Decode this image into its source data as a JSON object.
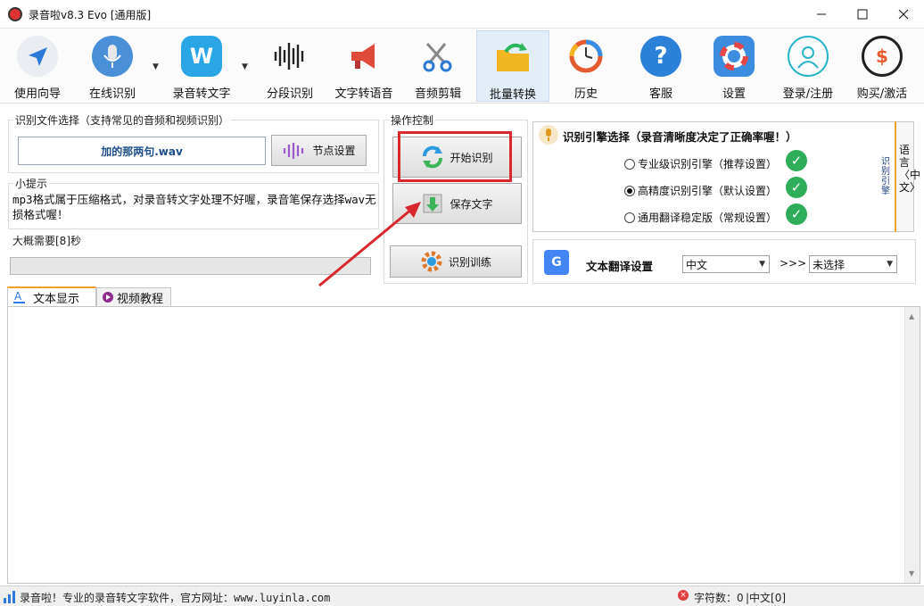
{
  "window": {
    "title": "录音啦v8.3 Evo [通用版]"
  },
  "toolbar": {
    "items": [
      {
        "label": "使用向导"
      },
      {
        "label": "在线识别"
      },
      {
        "label": "录音转文字"
      },
      {
        "label": "分段识别"
      },
      {
        "label": "文字转语音"
      },
      {
        "label": "音频剪辑"
      },
      {
        "label": "批量转换"
      },
      {
        "label": "历史"
      },
      {
        "label": "客服"
      },
      {
        "label": "设置"
      },
      {
        "label": "登录/注册"
      },
      {
        "label": "购买/激活"
      }
    ],
    "active": "批量转换"
  },
  "file_select": {
    "title": "识别文件选择（支持常见的音频和视频识别）",
    "filename": "加的那两句.wav",
    "segment_button": "节点设置"
  },
  "hint": {
    "title": "小提示",
    "text": "mp3格式属于压缩格式，对录音转文字处理不好喔，录音笔保存选择wav无损格式喔！"
  },
  "estimate": {
    "label": "大概需要[8]秒",
    "progress": 0
  },
  "operation": {
    "title": "操作控制",
    "start_button": "开始识别",
    "save_button": "保存文字",
    "train_button": "识别训练"
  },
  "engine": {
    "title": "识别引擎选择（录音清晰度决定了正确率喔！）",
    "options": [
      {
        "label": "专业级识别引擎（推荐设置）",
        "selected": false
      },
      {
        "label": "高精度识别引擎（默认设置）",
        "selected": true
      },
      {
        "label": "通用翻译稳定版（常规设置）",
        "selected": false
      }
    ],
    "side_tab_lang": "语言〈中文〉",
    "side_tab_engine": "识别引擎"
  },
  "translate": {
    "label": "文本翻译设置",
    "source": "中文",
    "arrow": ">>>",
    "target": "未选择"
  },
  "tabs": [
    {
      "label": "文本显示",
      "active": true
    },
    {
      "label": "视频教程",
      "active": false
    }
  ],
  "status": {
    "left": "录音啦！专业的录音转文字软件，官方网址：www.luyinla.com",
    "count": "字符数：0",
    "lang": "|中文[0]"
  },
  "colors": {
    "highlight_box": "#d9272e",
    "arrow": "#d9272e",
    "check": "#2fae5a",
    "accent": "#f0a030"
  }
}
